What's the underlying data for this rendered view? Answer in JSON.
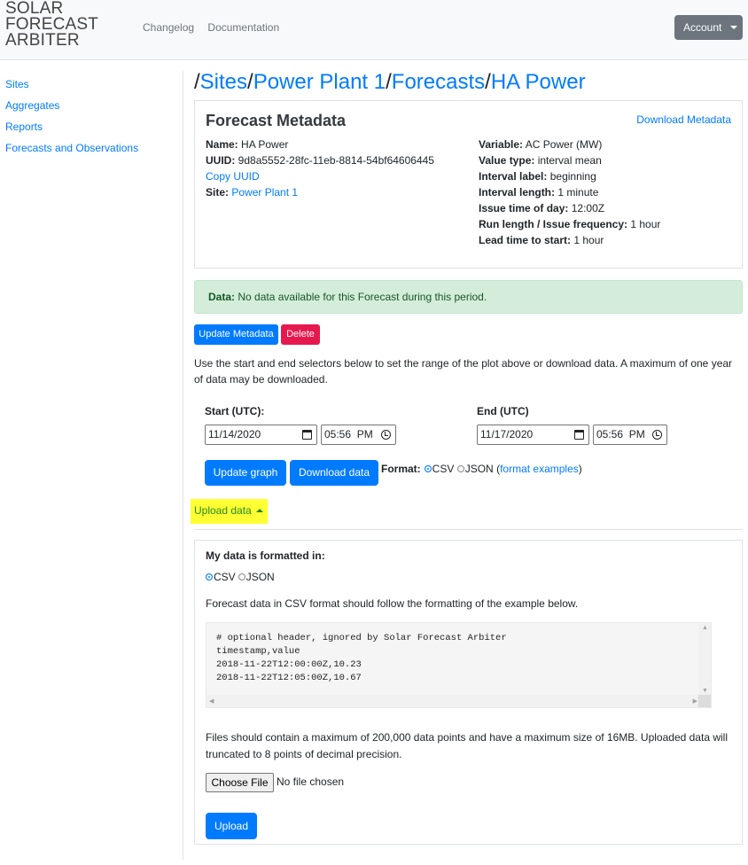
{
  "header": {
    "brand_lines": [
      "SOLAR",
      "FORECAST",
      "ARBITER"
    ],
    "nav": [
      "Changelog",
      "Documentation"
    ],
    "account_label": "Account"
  },
  "sidebar": {
    "items": [
      {
        "label": "Sites"
      },
      {
        "label": "Aggregates"
      },
      {
        "label": "Reports"
      },
      {
        "label": "Forecasts and Observations"
      }
    ]
  },
  "breadcrumb": {
    "sep": "/",
    "items": [
      "Sites",
      "Power Plant 1",
      "Forecasts",
      "HA Power"
    ]
  },
  "metadata": {
    "title": "Forecast Metadata",
    "download_label": "Download Metadata",
    "left": [
      {
        "key": "Name:",
        "value": "HA Power"
      },
      {
        "key": "UUID:",
        "value": "9d8a5552-28fc-11eb-8814-54bf64606445"
      }
    ],
    "copy_uuid": "Copy UUID",
    "site_key": "Site:",
    "site_value": "Power Plant 1",
    "right": [
      {
        "key": "Variable:",
        "value": "AC Power (MW)"
      },
      {
        "key": "Value type:",
        "value": "interval mean"
      },
      {
        "key": "Interval label:",
        "value": "beginning"
      },
      {
        "key": "Interval length:",
        "value": "1 minute"
      },
      {
        "key": "Issue time of day:",
        "value": "12:00Z"
      },
      {
        "key": "Run length / Issue frequency:",
        "value": "1 hour"
      },
      {
        "key": "Lead time to start:",
        "value": "1 hour"
      }
    ]
  },
  "alert": {
    "strong": "Data:",
    "text": "No data available for this Forecast during this period."
  },
  "actions": {
    "update_metadata": "Update Metadata",
    "delete": "Delete"
  },
  "range_help": "Use the start and end selectors below to set the range of the plot above or download data. A maximum of one year of data may be downloaded.",
  "range": {
    "start_label": "Start (UTC):",
    "start_date": "11/14/2020",
    "start_time": "05:56  PM",
    "end_label": "End (UTC)",
    "end_date": "11/17/2020",
    "end_time": "05:56  PM"
  },
  "download": {
    "update_graph": "Update graph",
    "download_data": "Download data",
    "format_label": "Format:",
    "csv": "CSV",
    "json": "JSON",
    "paren_open": "(",
    "format_examples": "format examples",
    "paren_close": ")"
  },
  "upload": {
    "toggle_label": "Upload data",
    "formatted_label": "My data is formatted in:",
    "csv": "CSV",
    "json": "JSON",
    "csv_help": "Forecast data in CSV format should follow the formatting of the example below.",
    "code_lines": [
      "# optional header, ignored by Solar Forecast Arbiter",
      "timestamp,value",
      "2018-11-22T12:00:00Z,10.23",
      "2018-11-22T12:05:00Z,10.67"
    ],
    "limits": "Files should contain a maximum of 200,000 data points and have a maximum size of 16MB. Uploaded data will truncated to 8 points of decimal precision.",
    "choose_file": "Choose File",
    "no_file": "No file chosen",
    "upload_button": "Upload"
  }
}
